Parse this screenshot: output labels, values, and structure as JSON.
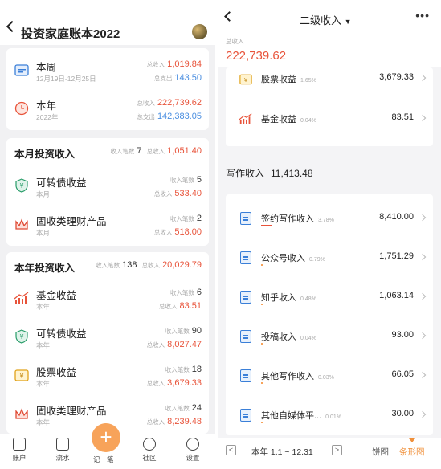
{
  "left": {
    "title": "投资家庭账本2022",
    "summary": [
      {
        "title": "本周",
        "sub": "12月19日-12月25日",
        "income_label": "总收入",
        "income": "1,019.84",
        "expense_label": "总支出",
        "expense": "143.50"
      },
      {
        "title": "本年",
        "sub": "2022年",
        "income_label": "总收入",
        "income": "222,739.62",
        "expense_label": "总支出",
        "expense": "142,383.05"
      }
    ],
    "month": {
      "title": "本月投资收入",
      "count_label": "收入笔数",
      "count": "7",
      "total_label": "总收入",
      "total": "1,051.40",
      "items": [
        {
          "title": "可转债收益",
          "sub": "本月",
          "count_label": "收入笔数",
          "count": "5",
          "total_label": "总收入",
          "total": "533.40"
        },
        {
          "title": "固收类理财产品",
          "sub": "本月",
          "count_label": "收入笔数",
          "count": "2",
          "total_label": "总收入",
          "total": "518.00"
        }
      ]
    },
    "year": {
      "title": "本年投资收入",
      "count_label": "收入笔数",
      "count": "138",
      "total_label": "总收入",
      "total": "20,029.79",
      "items": [
        {
          "title": "基金收益",
          "sub": "本年",
          "count_label": "收入笔数",
          "count": "6",
          "total_label": "总收入",
          "total": "83.51"
        },
        {
          "title": "可转债收益",
          "sub": "本年",
          "count_label": "收入笔数",
          "count": "90",
          "total_label": "总收入",
          "total": "8,027.47"
        },
        {
          "title": "股票收益",
          "sub": "本年",
          "count_label": "收入笔数",
          "count": "18",
          "total_label": "总收入",
          "total": "3,679.33"
        },
        {
          "title": "固收类理财产品",
          "sub": "本年",
          "count_label": "收入笔数",
          "count": "24",
          "total_label": "总收入",
          "total": "8,239.48"
        }
      ]
    },
    "nav": {
      "account": "账户",
      "flow": "流水",
      "add": "记一笔",
      "community": "社区",
      "settings": "设置"
    }
  },
  "right": {
    "title": "二级收入",
    "total_label": "总收入",
    "total": "222,739.62",
    "invest_items": [
      {
        "name": "股票收益",
        "pct": "1.65%",
        "value": "3,679.33"
      },
      {
        "name": "基金收益",
        "pct": "0.04%",
        "value": "83.51"
      }
    ],
    "writing": {
      "title": "写作收入",
      "total": "11,413.48",
      "items": [
        {
          "name": "签约写作收入",
          "pct": "3.78%",
          "value": "8,410.00",
          "bar": 0.35,
          "color": "#e8533a"
        },
        {
          "name": "公众号收入",
          "pct": "0.79%",
          "value": "1,751.29",
          "bar": 0.07,
          "color": "#f7a35a"
        },
        {
          "name": "知乎收入",
          "pct": "0.48%",
          "value": "1,063.14",
          "bar": 0.04,
          "color": "#f7a35a"
        },
        {
          "name": "投稿收入",
          "pct": "0.04%",
          "value": "93.00",
          "bar": 0.01,
          "color": "#f7a35a"
        },
        {
          "name": "其他写作收入",
          "pct": "0.03%",
          "value": "66.05",
          "bar": 0.01,
          "color": "#f7a35a"
        },
        {
          "name": "其他自媒体平...",
          "pct": "0.01%",
          "value": "30.00",
          "bar": 0.01,
          "color": "#f7a35a"
        }
      ]
    },
    "footer": {
      "prev": "<",
      "range": "本年 1.1 ~ 12.31",
      "next": ">",
      "pie": "饼图",
      "bar": "条形图"
    }
  }
}
